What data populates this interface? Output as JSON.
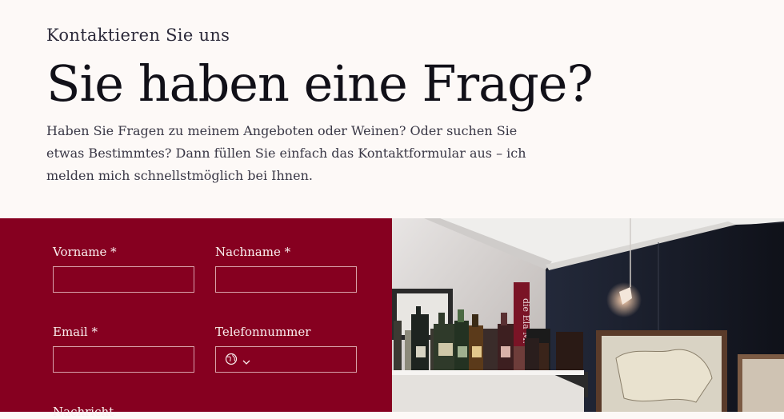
{
  "intro": {
    "eyebrow": "Kontaktieren Sie uns",
    "headline": "Sie haben eine Frage?",
    "lead": "Haben Sie Fragen zu meinem Angeboten oder Weinen? Oder suchen Sie etwas Bestimmtes? Dann füllen Sie einfach das Kontaktformular aus – ich melden mich schnellstmöglich bei Ihnen."
  },
  "form": {
    "first_name_label": "Vorname *",
    "last_name_label": "Nachname *",
    "email_label": "Email *",
    "phone_label": "Telefonnummer",
    "message_label": "Nachricht",
    "first_name_value": "",
    "last_name_value": "",
    "email_value": "",
    "phone_value": "",
    "country_icon": "globe-icon",
    "dropdown_icon": "chevron-down-icon"
  },
  "photo": {
    "sign_text": "die Ela M. Roh"
  },
  "colors": {
    "page_background": "#fdf9f7",
    "form_background": "#860020",
    "headline": "#111018",
    "field_border": "#d9a0ac"
  }
}
